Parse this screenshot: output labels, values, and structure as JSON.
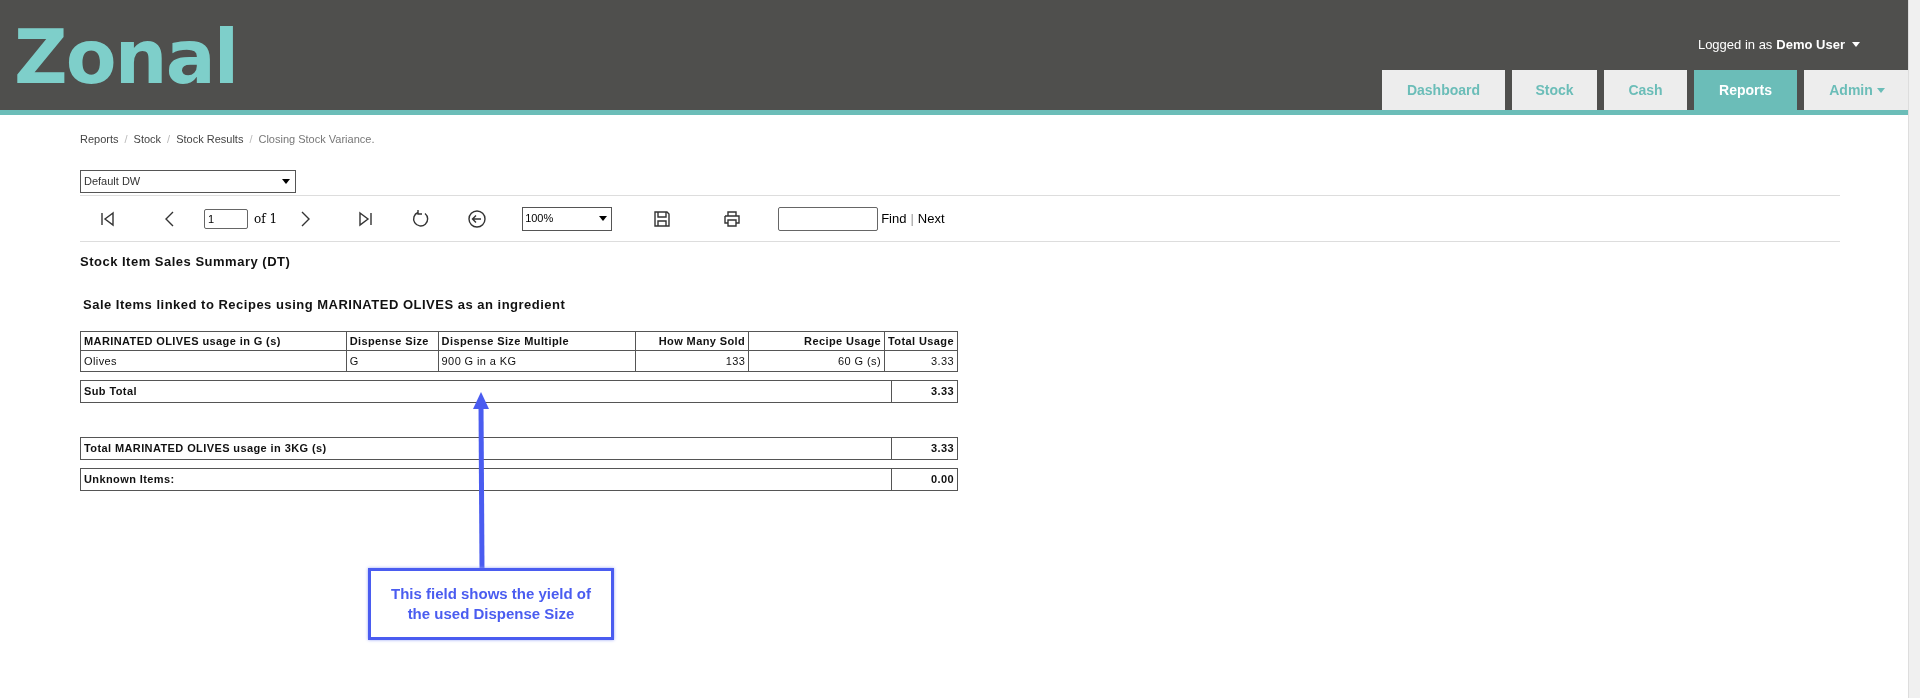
{
  "header": {
    "logo": "Zonal",
    "user_prefix": "Logged in as",
    "user_name": "Demo User",
    "tabs": [
      {
        "label": "Dashboard",
        "selected": false,
        "dropdown": false
      },
      {
        "label": "Stock",
        "selected": false,
        "dropdown": false
      },
      {
        "label": "Cash",
        "selected": false,
        "dropdown": false
      },
      {
        "label": "Reports",
        "selected": true,
        "dropdown": false
      },
      {
        "label": "Admin",
        "selected": false,
        "dropdown": true
      }
    ]
  },
  "breadcrumb": {
    "separator": "/",
    "items": [
      "Reports",
      "Stock",
      "Stock Results",
      "Closing Stock Variance."
    ]
  },
  "layout_select": {
    "value": "Default DW"
  },
  "toolbar": {
    "page": "1",
    "of": "of 1",
    "zoom": "100%",
    "find": "Find",
    "separator": "|",
    "next": "Next"
  },
  "report": {
    "title": "Stock Item Sales Summary (DT)",
    "subtitle": "Sale Items linked to Recipes using MARINATED OLIVES as an ingredient",
    "table": {
      "columns": [
        "MARINATED OLIVES usage in G (s)",
        "Dispense Size",
        "Dispense Size Multiple",
        "How Many Sold",
        "Recipe Usage",
        "Total Usage"
      ],
      "rows": [
        [
          "Olives",
          "G",
          "900 G in a KG",
          "133",
          "60 G (s)",
          "3.33"
        ]
      ]
    },
    "total_sections": [
      [
        {
          "label": "Sub Total",
          "value": "3.33"
        }
      ],
      [
        {
          "label": "Total MARINATED OLIVES usage in 3KG (s)",
          "value": "3.33"
        },
        {
          "label": "Unknown Items:",
          "value": "0.00"
        }
      ]
    ]
  },
  "callout": {
    "text": "This field shows the yield of the used Dispense Size"
  }
}
